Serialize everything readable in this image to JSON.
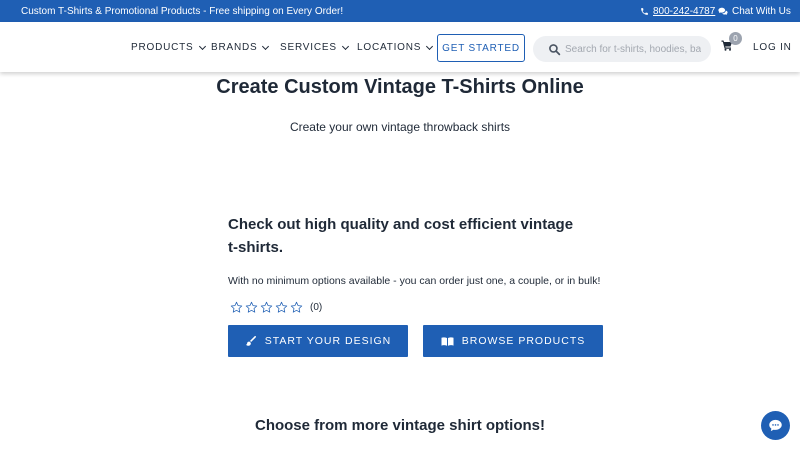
{
  "topbar": {
    "promo_text": "Custom T-Shirts & Promotional Products - Free shipping on Every Order!",
    "phone": "800-242-4787",
    "chat_label": "Chat With Us",
    "background_color": "#1f5fb4"
  },
  "nav": {
    "items": [
      {
        "label": "PRODUCTS"
      },
      {
        "label": "BRANDS"
      },
      {
        "label": "SERVICES"
      },
      {
        "label": "LOCATIONS"
      }
    ],
    "cta_label": "GET STARTED",
    "search_placeholder": "Search for t-shirts, hoodies, ba",
    "cart_count": "0",
    "login_label": "LOG IN"
  },
  "hero": {
    "title": "Create Custom Vintage T-Shirts Online",
    "subtitle": "Create your own vintage throwback shirts"
  },
  "product": {
    "title": "Check out high quality and cost efficient vintage t-shirts.",
    "description": "With no minimum options available - you can order just one, a couple, or in bulk!",
    "rating_stars": 0,
    "rating_max": 5,
    "rating_count": "(0)",
    "design_button": "START YOUR DESIGN",
    "browse_button": "BROWSE PRODUCTS"
  },
  "more": {
    "title": "Choose from more vintage shirt options!"
  },
  "icons": {
    "phone": "phone-icon",
    "chat": "chat-icon",
    "search": "search-icon",
    "cart": "cart-icon",
    "brush": "paintbrush-icon",
    "book": "book-icon",
    "chat_bubble": "chat-bubble-icon"
  },
  "colors": {
    "brand_blue": "#1f5fb4",
    "text": "#1f2937",
    "star_outline": "#1f5fb4"
  }
}
